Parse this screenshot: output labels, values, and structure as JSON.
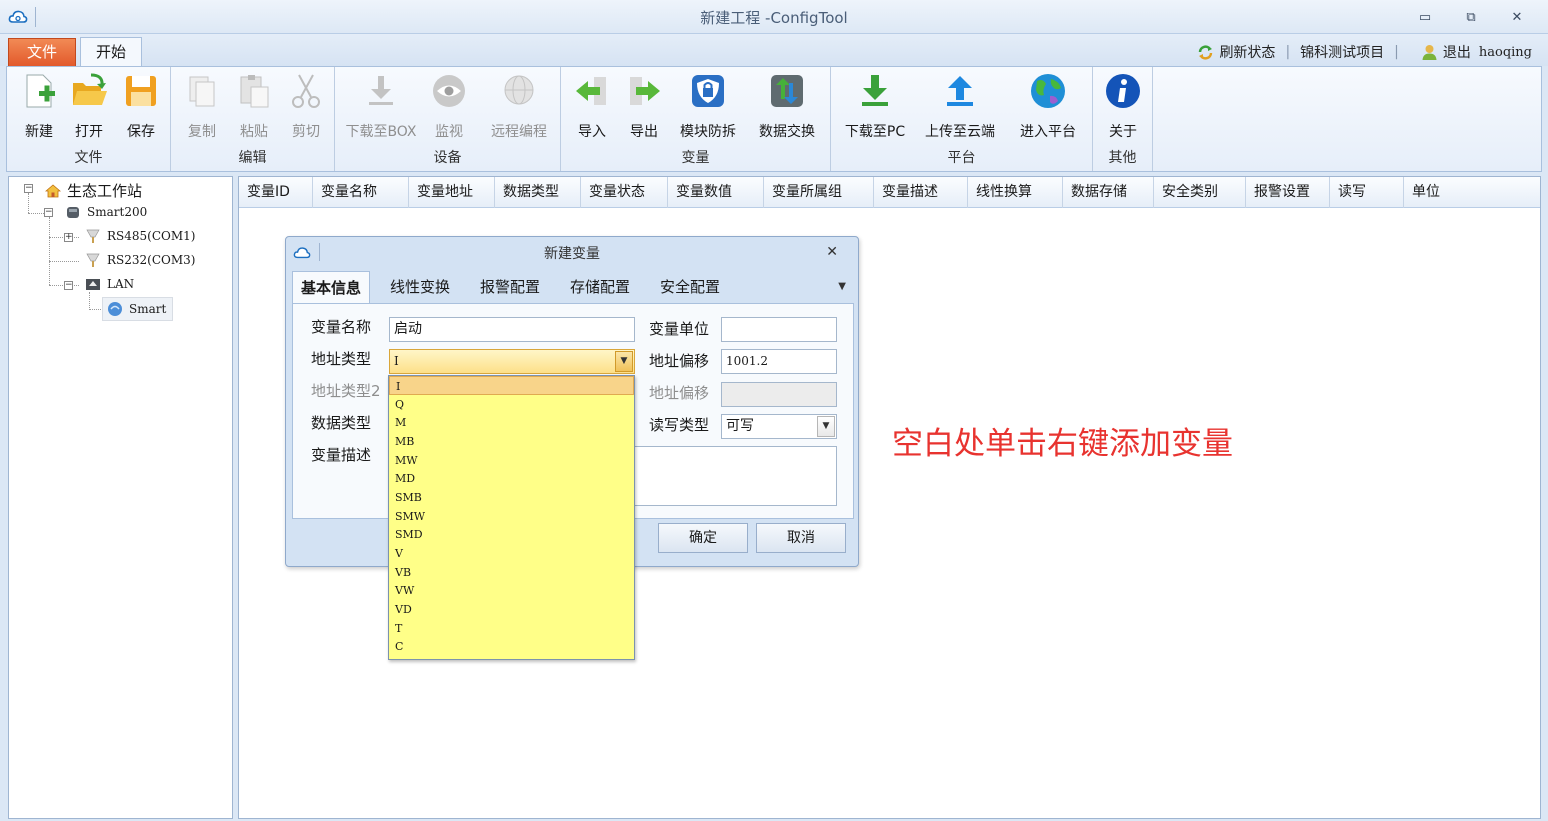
{
  "window": {
    "title": "新建工程 -ConfigTool",
    "controls": [
      "minimize-icon",
      "restore-icon",
      "close-icon"
    ]
  },
  "ribbon_tabs": {
    "file": "文件",
    "start": "开始"
  },
  "top_right": {
    "refresh": "刷新状态",
    "project": "锦科测试项目",
    "logout": "退出",
    "user": "haoqing"
  },
  "ribbon": {
    "groups": {
      "file": "文件",
      "edit": "编辑",
      "device": "设备",
      "variable": "变量",
      "platform": "平台",
      "other": "其他"
    },
    "buttons": {
      "new": "新建",
      "open": "打开",
      "save": "保存",
      "copy": "复制",
      "paste": "粘贴",
      "cut": "剪切",
      "download_box": "下载至BOX",
      "monitor": "监视",
      "remote": "远程编程",
      "import": "导入",
      "export": "导出",
      "protect": "模块防拆",
      "exchange": "数据交换",
      "download_pc": "下载至PC",
      "upload_cloud": "上传至云端",
      "enter_platform": "进入平台",
      "about": "关于"
    }
  },
  "tree": {
    "root": "生态工作站",
    "device": "Smart200",
    "rs485": "RS485(COM1)",
    "rs232": "RS232(COM3)",
    "lan": "LAN",
    "smart": "Smart"
  },
  "grid": {
    "columns": [
      "变量ID",
      "变量名称",
      "变量地址",
      "数据类型",
      "变量状态",
      "变量数值",
      "变量所属组",
      "变量描述",
      "线性换算",
      "数据存储",
      "安全类别",
      "报警设置",
      "读写",
      "单位"
    ]
  },
  "hint": "空白处单击右键添加变量",
  "dialog": {
    "title": "新建变量",
    "tabs": [
      "基本信息",
      "线性变换",
      "报警配置",
      "存储配置",
      "安全配置"
    ],
    "labels": {
      "var_name": "变量名称",
      "addr_type": "地址类型",
      "addr_type2": "地址类型2",
      "data_type": "数据类型",
      "var_desc": "变量描述",
      "var_unit": "变量单位",
      "addr_offset": "地址偏移",
      "addr_offset2": "地址偏移",
      "rw_type": "读写类型"
    },
    "values": {
      "var_name": "启动",
      "addr_type": "I",
      "addr_offset": "1001.2",
      "rw_type": "可写",
      "var_unit": ""
    },
    "ok": "确定",
    "cancel": "取消"
  },
  "dropdown": {
    "selected": "I",
    "options": [
      "I",
      "Q",
      "M",
      "MB",
      "MW",
      "MD",
      "SMB",
      "SMW",
      "SMD",
      "V",
      "VB",
      "VW",
      "VD",
      "T",
      "C"
    ]
  }
}
